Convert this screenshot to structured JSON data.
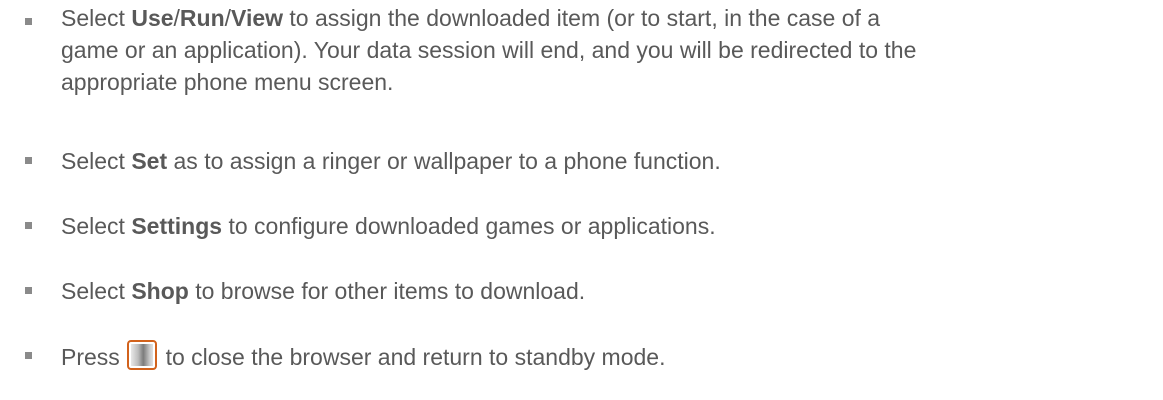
{
  "items": [
    {
      "prefix": "Select ",
      "b1": "Use",
      "sep1": "/",
      "b2": "Run",
      "sep2": "/",
      "b3": "View",
      "line1_rest": " to assign the downloaded item (or to start, in the case of a",
      "line2": "game or an application). Your data session will end, and you will be redirected to the",
      "line3": "appropriate phone menu screen."
    },
    {
      "prefix": "Select ",
      "bold": "Set",
      "suffix": " as to assign a ringer or wallpaper to a phone function."
    },
    {
      "prefix": "Select ",
      "bold": "Settings",
      "suffix": " to configure downloaded games or applications."
    },
    {
      "prefix": "Select ",
      "bold": "Shop",
      "suffix": " to browse for other items to download."
    },
    {
      "prefix": "Press ",
      "icon": "end-key-icon",
      "suffix": " to close the browser and return to standby mode."
    }
  ],
  "colors": {
    "text": "#595959",
    "bullet": "#8a8a8a",
    "key_border": "#d2621c"
  }
}
